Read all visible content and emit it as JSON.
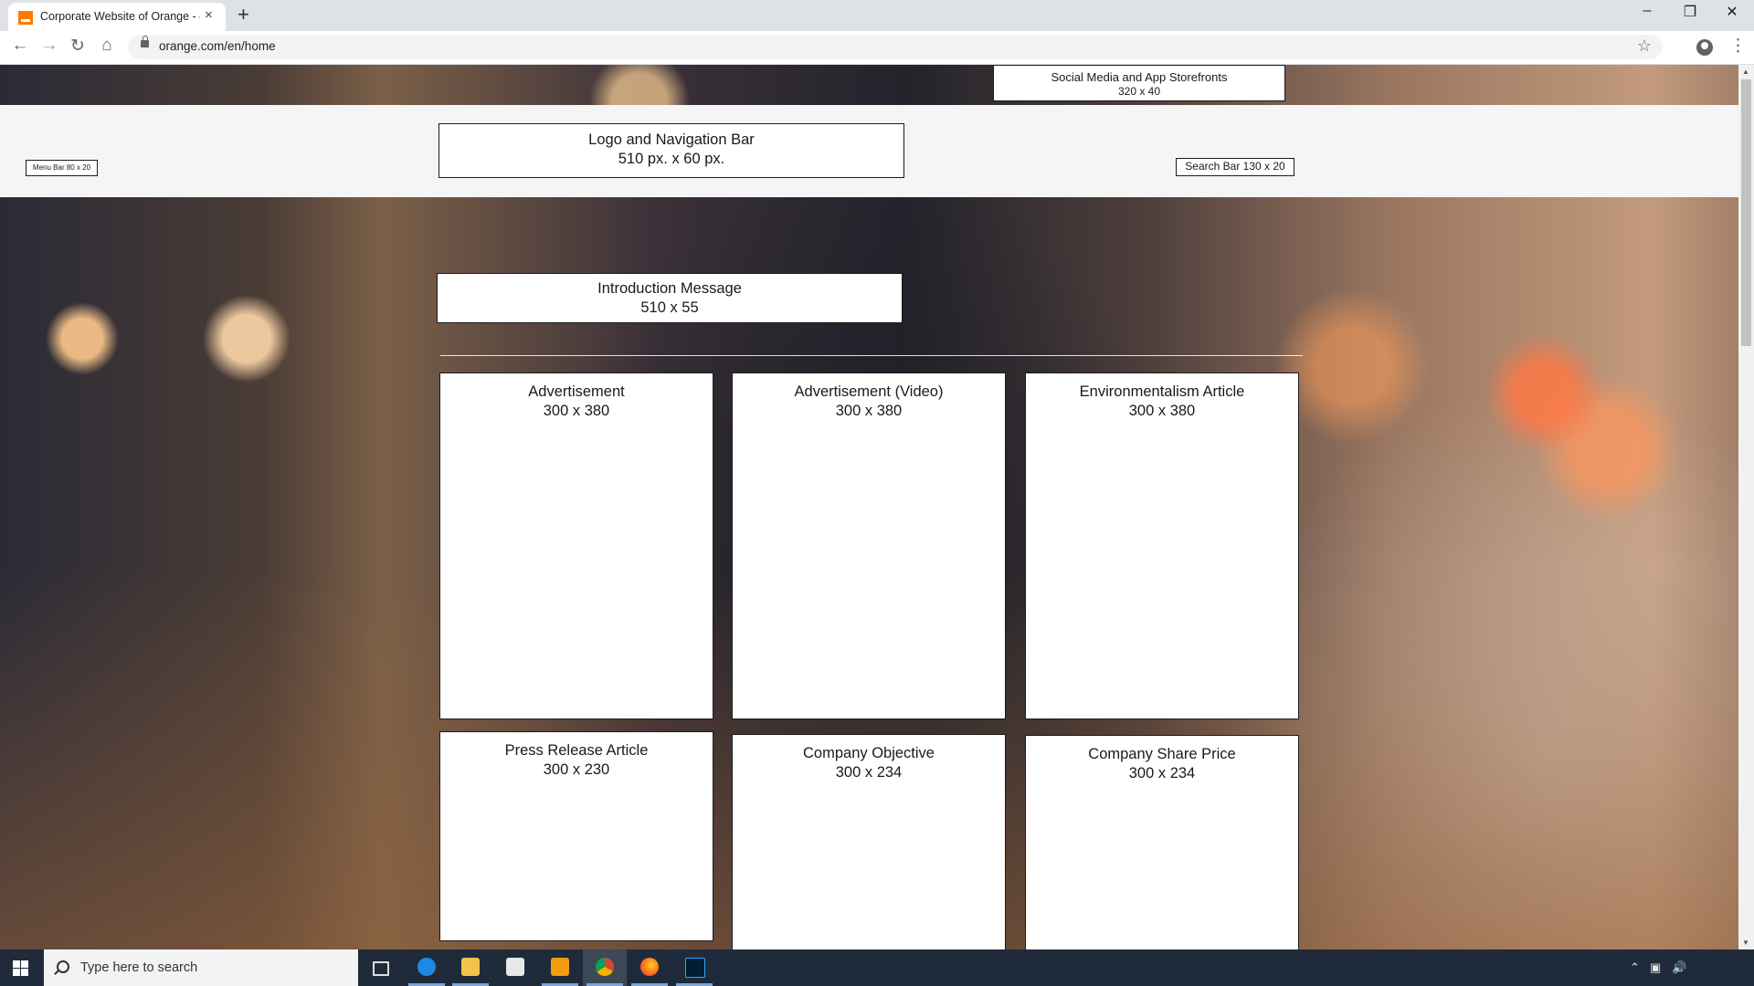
{
  "browser": {
    "tab_title": "Corporate Website of Orange - o",
    "url": "orange.com/en/home",
    "new_tab": "+",
    "close_tab": "×"
  },
  "page": {
    "social": {
      "title": "Social Media and App Storefronts",
      "size": "320 x 40"
    },
    "menu": {
      "title": "Menu Bar 80 x 20"
    },
    "logo_nav": {
      "title": "Logo and Navigation Bar",
      "size": "510 px. x 60 px."
    },
    "search": {
      "title": "Search Bar 130 x 20"
    },
    "intro": {
      "title": "Introduction Message",
      "size": "510 x 55"
    },
    "cards": [
      {
        "title": "Advertisement",
        "size": "300 x 380"
      },
      {
        "title": "Advertisement (Video)",
        "size": "300 x 380"
      },
      {
        "title": "Environmentalism Article",
        "size": "300 x 380"
      },
      {
        "title": "Press Release Article",
        "size": "300 x 230"
      },
      {
        "title": "Company Objective",
        "size": "300 x 234"
      },
      {
        "title": "Company Share Price",
        "size": "300 x 234"
      }
    ]
  },
  "taskbar": {
    "search_placeholder": "Type here to search",
    "apps": [
      "task-view",
      "edge",
      "file-explorer",
      "store",
      "sublime-text",
      "chrome",
      "firefox",
      "photoshop"
    ]
  },
  "colors": {
    "brand_orange": "#ff7900",
    "taskbar": "#1f2b3b"
  }
}
